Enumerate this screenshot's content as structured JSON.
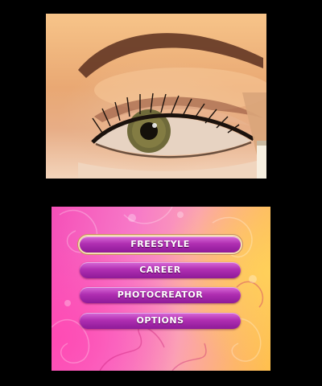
{
  "top_screen": {
    "image": "close-up-eye-eyeshadow-photo"
  },
  "menu": {
    "items": [
      {
        "label": "FREESTYLE",
        "selected": true
      },
      {
        "label": "CAREER",
        "selected": false
      },
      {
        "label": "PHOTOCREATOR",
        "selected": false
      },
      {
        "label": "OPTIONS",
        "selected": false
      }
    ]
  },
  "colors": {
    "background": "#000000",
    "button_purple": "#b02fb2",
    "button_highlight": "#f4ddb0",
    "menu_bg_pink": "#f54fb8",
    "menu_bg_orange": "#ffc04c"
  }
}
